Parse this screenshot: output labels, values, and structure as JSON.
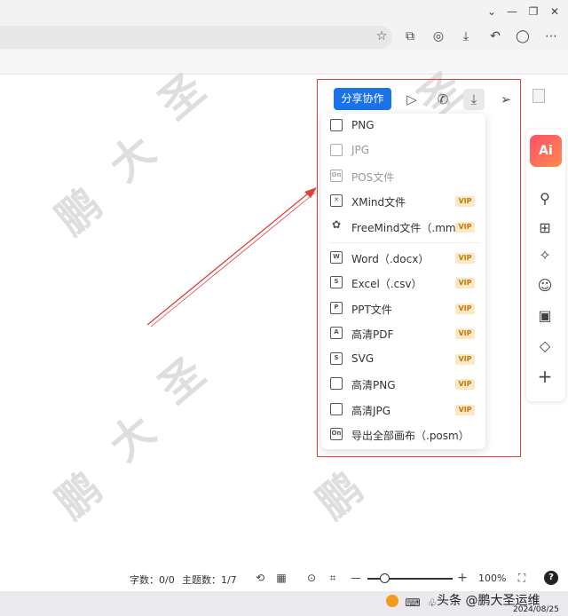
{
  "window": {
    "minimize": "⌄",
    "restore": "—",
    "maximize": "❐",
    "close": "✕"
  },
  "toolbar": {
    "star": "☆",
    "extensions": "⧉",
    "screenshot": "◎",
    "download": "⤓",
    "back": "↶",
    "profile": "◯",
    "more": "⋯"
  },
  "watermark": {
    "chars": [
      "鹏",
      "大",
      "圣"
    ]
  },
  "export_bar": {
    "share_label": "分享协作",
    "icons": {
      "play": "▷",
      "call": "✆",
      "download": "⤓",
      "send": "➢"
    }
  },
  "export_menu": {
    "items": [
      {
        "label": "PNG",
        "icon": "image-icon",
        "vip": false,
        "disabled": false
      },
      {
        "label": "JPG",
        "icon": "image-icon",
        "vip": false,
        "disabled": true
      },
      {
        "label": "POS文件",
        "icon": "on-file-icon",
        "vip": false,
        "disabled": true
      },
      {
        "label": "XMind文件",
        "icon": "xmind-icon",
        "vip": true,
        "disabled": false
      },
      {
        "label": "FreeMind文件（.mm）",
        "icon": "freemind-icon",
        "vip": true,
        "disabled": false
      },
      {
        "label": "Word（.docx）",
        "icon": "word-icon",
        "vip": true,
        "disabled": false
      },
      {
        "label": "Excel（.csv）",
        "icon": "excel-icon",
        "vip": true,
        "disabled": false
      },
      {
        "label": "PPT文件",
        "icon": "ppt-icon",
        "vip": true,
        "disabled": false
      },
      {
        "label": "高清PDF",
        "icon": "pdf-icon",
        "vip": true,
        "disabled": false
      },
      {
        "label": "SVG",
        "icon": "svg-icon",
        "vip": true,
        "disabled": false
      },
      {
        "label": "高清PNG",
        "icon": "image-icon",
        "vip": true,
        "disabled": false
      },
      {
        "label": "高清JPG",
        "icon": "image-icon",
        "vip": true,
        "disabled": false
      },
      {
        "label": "导出全部画布（.posm）",
        "icon": "on-file-icon",
        "vip": false,
        "disabled": false
      }
    ],
    "vip_badge": "VIP"
  },
  "side_panel": {
    "ai_label": "Ai",
    "icons": [
      "⚲",
      "⊞",
      "✧",
      "☺",
      "▣",
      "◇",
      "+"
    ]
  },
  "status_bar": {
    "word_count": "字数：0/0",
    "topic_count": "主题数：1/7",
    "zoom": "100%",
    "zoom_level": 0.2,
    "help": "?"
  },
  "taskbar": {
    "brand_text": "头条 @鹏大圣运维",
    "date": "2024/08/25"
  },
  "colors": {
    "accent": "#1a73e8",
    "highlight": "#e0403a",
    "arrow": "#e0403a",
    "vip_bg": "#fde8c4",
    "vip_fg": "#c07a13"
  }
}
